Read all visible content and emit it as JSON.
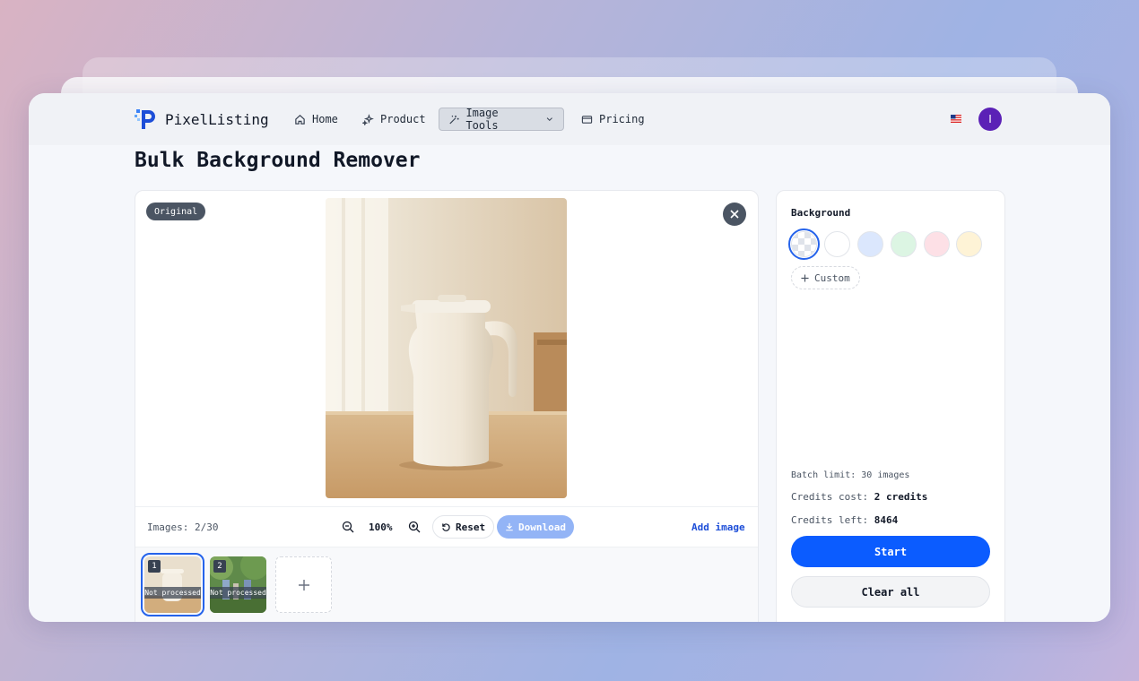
{
  "nav": {
    "brand": "PixelListing",
    "items": [
      {
        "label": "Home",
        "icon": "home-icon"
      },
      {
        "label": "Product",
        "icon": "sparkles-icon"
      },
      {
        "label": "Image Tools",
        "icon": "magic-wand-icon",
        "active": true
      },
      {
        "label": "Pricing",
        "icon": "credit-card-icon"
      }
    ],
    "avatar_initial": "I"
  },
  "page": {
    "title": "Bulk Background Remover"
  },
  "preview": {
    "badge": "Original",
    "images_count": "Images: 2/30",
    "zoom": "100%",
    "reset_label": "Reset",
    "download_label": "Download",
    "add_image_label": "Add image"
  },
  "thumbnails": [
    {
      "num": "1",
      "status": "Not processed",
      "selected": true
    },
    {
      "num": "2",
      "status": "Not processed",
      "selected": false
    }
  ],
  "background": {
    "title": "Background",
    "swatches": [
      "transparent",
      "#ffffff",
      "#dbe7fd",
      "#dcf5e3",
      "#fde0e6",
      "#fef3d6"
    ],
    "custom_label": "Custom"
  },
  "summary": {
    "batch_limit": "Batch limit: 30 images",
    "credits_cost_label": "Credits cost:",
    "credits_cost_value": "2 credits",
    "credits_left_label": "Credits left:",
    "credits_left_value": "8464"
  },
  "actions": {
    "start_label": "Start",
    "clear_label": "Clear all"
  },
  "colors": {
    "accent": "#0b5cff",
    "avatar": "#5b21b6"
  }
}
